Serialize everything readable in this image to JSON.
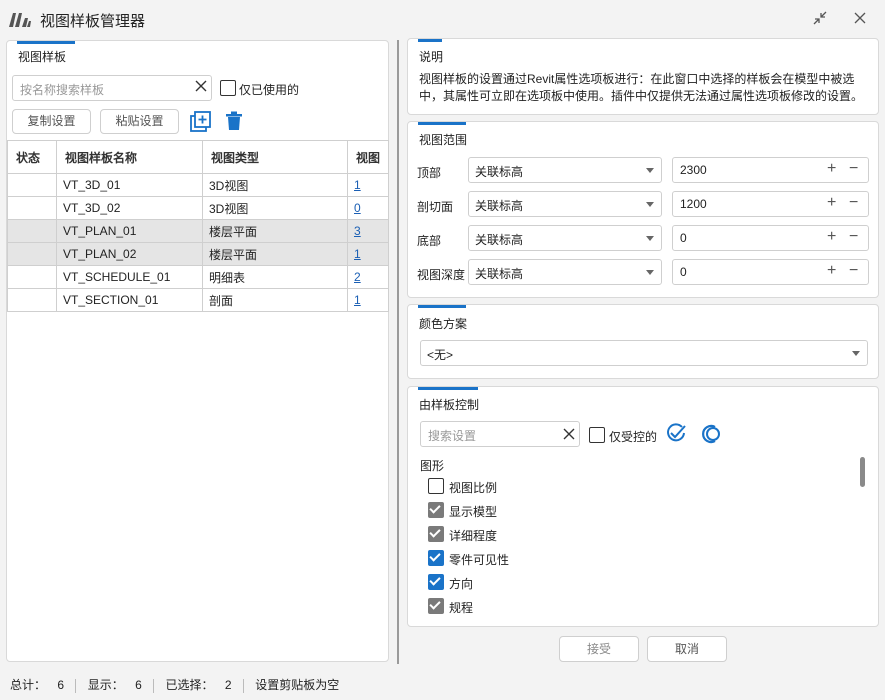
{
  "window": {
    "title": "视图样板管理器",
    "restore_icon": "collapse-arrows-icon",
    "close_icon": "close-icon"
  },
  "left_panel": {
    "tab_label": "视图样板",
    "search_placeholder": "按名称搜索样板",
    "only_used_label": "仅已使用的",
    "copy_button": "复制设置",
    "paste_button": "粘贴设置",
    "columns": [
      "状态",
      "视图样板名称",
      "视图类型",
      "视图"
    ],
    "rows": [
      {
        "status": "",
        "name": "VT_3D_01",
        "type": "3D视图",
        "views": "1"
      },
      {
        "status": "",
        "name": "VT_3D_02",
        "type": "3D视图",
        "views": "0"
      },
      {
        "status": "",
        "name": "VT_PLAN_01",
        "type": "楼层平面",
        "views": "3"
      },
      {
        "status": "",
        "name": "VT_PLAN_02",
        "type": "楼层平面",
        "views": "1"
      },
      {
        "status": "",
        "name": "VT_SCHEDULE_01",
        "type": "明细表",
        "views": "2"
      },
      {
        "status": "",
        "name": "VT_SECTION_01",
        "type": "剖面",
        "views": "1"
      }
    ]
  },
  "description": {
    "tab_label": "说明",
    "text": "视图样板的设置通过Revit属性选项板进行：在此窗口中选择的样板会在模型中被选中，其属性可立即在选项板中使用。插件中仅提供无法通过属性选项板修改的设置。"
  },
  "view_range": {
    "tab_label": "视图范围",
    "rows": [
      {
        "label": "顶部",
        "level": "关联标高",
        "offset": "2300"
      },
      {
        "label": "剖切面",
        "level": "关联标高",
        "offset": "1200"
      },
      {
        "label": "底部",
        "level": "关联标高",
        "offset": "0"
      },
      {
        "label": "视图深度",
        "level": "关联标高",
        "offset": "0"
      }
    ]
  },
  "color_scheme": {
    "tab_label": "颜色方案",
    "value": "<无>"
  },
  "template_control": {
    "tab_label": "由样板控制",
    "search_placeholder": "搜索设置",
    "only_controlled_label": "仅受控的",
    "group_label": "图形",
    "items": [
      {
        "label": "视图比例",
        "state": "unchecked"
      },
      {
        "label": "显示模型",
        "state": "checked-gray"
      },
      {
        "label": "详细程度",
        "state": "checked-gray"
      },
      {
        "label": "零件可见性",
        "state": "checked-blue"
      },
      {
        "label": "方向",
        "state": "checked-blue"
      },
      {
        "label": "规程",
        "state": "checked-gray"
      }
    ]
  },
  "footer": {
    "accept": "接受",
    "cancel": "取消"
  },
  "statusbar": {
    "total_label": "总计：",
    "total": "6",
    "shown_label": "显示：",
    "shown": "6",
    "selected_label": "已选择：",
    "selected": "2",
    "message": "设置剪贴板为空"
  },
  "colors": {
    "accent": "#1a73c8",
    "link": "#1a5fb4"
  }
}
